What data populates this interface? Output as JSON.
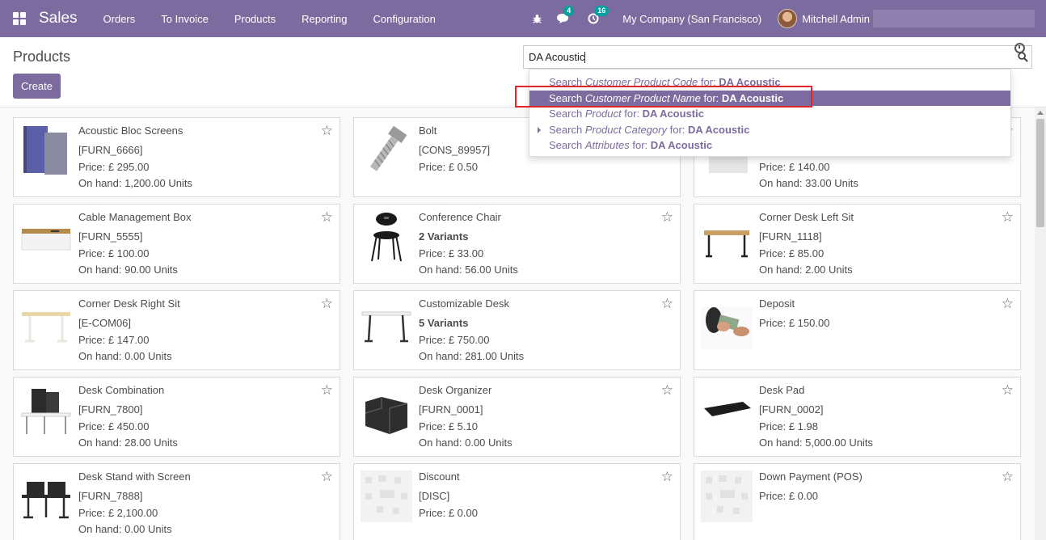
{
  "navbar": {
    "app_name": "Sales",
    "menu": [
      "Orders",
      "To Invoice",
      "Products",
      "Reporting",
      "Configuration"
    ],
    "messages_count": "4",
    "activities_count": "16",
    "company": "My Company (San Francisco)",
    "user": "Mitchell Admin",
    "brand_color": "#7c6b9e"
  },
  "control_panel": {
    "title": "Products",
    "create_label": "Create",
    "search_value": "DA Acoustic"
  },
  "autocomplete": [
    {
      "prefix": "Search ",
      "field": "Customer Product Code",
      "middle": " for: ",
      "term": "DA Acoustic",
      "active": false,
      "expandable": false
    },
    {
      "prefix": "Search ",
      "field": "Customer Product Name",
      "middle": " for: ",
      "term": "DA Acoustic",
      "active": true,
      "expandable": false
    },
    {
      "prefix": "Search ",
      "field": "Product",
      "middle": " for: ",
      "term": "DA Acoustic",
      "active": false,
      "expandable": false
    },
    {
      "prefix": "Search ",
      "field": "Product Category",
      "middle": " for: ",
      "term": "DA Acoustic",
      "active": false,
      "expandable": true
    },
    {
      "prefix": "Search ",
      "field": "Attributes",
      "middle": " for: ",
      "term": "DA Acoustic",
      "active": false,
      "expandable": false
    }
  ],
  "products": [
    {
      "name": "Acoustic Bloc Screens",
      "ref": "[FURN_6666]",
      "variants": "",
      "price": "Price: £ 295.00",
      "onhand": "On hand: 1,200.00 Units",
      "icon": "acoustic-screen-image"
    },
    {
      "name": "Bolt",
      "ref": "[CONS_89957]",
      "variants": "",
      "price": "Price: £ 0.50",
      "onhand": "",
      "icon": "bolt-image"
    },
    {
      "name": "",
      "ref": "",
      "variants": "",
      "price": "Price: £ 140.00",
      "onhand": "On hand: 33.00 Units",
      "icon": "cabinet-image"
    },
    {
      "name": "Cable Management Box",
      "ref": "[FURN_5555]",
      "variants": "",
      "price": "Price: £ 100.00",
      "onhand": "On hand: 90.00 Units",
      "icon": "cable-box-image"
    },
    {
      "name": "Conference Chair",
      "ref": "",
      "variants": "2 Variants",
      "price": "Price: £ 33.00",
      "onhand": "On hand: 56.00 Units",
      "icon": "chair-image"
    },
    {
      "name": "Corner Desk Left Sit",
      "ref": "[FURN_1118]",
      "variants": "",
      "price": "Price: £ 85.00",
      "onhand": "On hand: 2.00 Units",
      "icon": "desk-image"
    },
    {
      "name": "Corner Desk Right Sit",
      "ref": "[E-COM06]",
      "variants": "",
      "price": "Price: £ 147.00",
      "onhand": "On hand: 0.00 Units",
      "icon": "desk-image"
    },
    {
      "name": "Customizable Desk",
      "ref": "",
      "variants": "5 Variants",
      "price": "Price: £ 750.00",
      "onhand": "On hand: 281.00 Units",
      "icon": "desk-image"
    },
    {
      "name": "Deposit",
      "ref": "",
      "variants": "",
      "price": "Price: £ 150.00",
      "onhand": "",
      "icon": "money-image"
    },
    {
      "name": "Desk Combination",
      "ref": "[FURN_7800]",
      "variants": "",
      "price": "Price: £ 450.00",
      "onhand": "On hand: 28.00 Units",
      "icon": "desk-combination-image"
    },
    {
      "name": "Desk Organizer",
      "ref": "[FURN_0001]",
      "variants": "",
      "price": "Price: £ 5.10",
      "onhand": "On hand: 0.00 Units",
      "icon": "organizer-image"
    },
    {
      "name": "Desk Pad",
      "ref": "[FURN_0002]",
      "variants": "",
      "price": "Price: £ 1.98",
      "onhand": "On hand: 5,000.00 Units",
      "icon": "desk-pad-image"
    },
    {
      "name": "Desk Stand with Screen",
      "ref": "[FURN_7888]",
      "variants": "",
      "price": "Price: £ 2,100.00",
      "onhand": "On hand: 0.00 Units",
      "icon": "desk-stand-image"
    },
    {
      "name": "Discount",
      "ref": "[DISC]",
      "variants": "",
      "price": "Price: £ 0.00",
      "onhand": "",
      "icon": "placeholder-image"
    },
    {
      "name": "Down Payment (POS)",
      "ref": "",
      "variants": "",
      "price": "Price: £ 0.00",
      "onhand": "",
      "icon": "placeholder-image"
    }
  ]
}
